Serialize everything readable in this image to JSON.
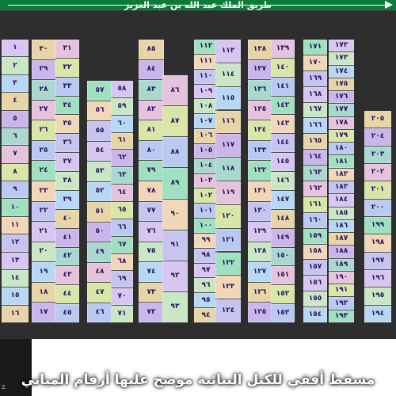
{
  "header": {
    "street_label": "طريق الملك عبد الله بن عبد العزيز"
  },
  "caption": "مسقط أفقي للكتل البنائية موضح عليها أرقام المباني",
  "corner_note": "2.",
  "colors": {
    "road_green": "#0c7a3a",
    "label_text": "#2a145e"
  },
  "map": {
    "columns": [
      {
        "id": 1,
        "labels": [
          "١",
          "٢",
          "٣",
          "٤",
          "٥",
          "٦",
          "٧",
          "٨",
          "٩",
          "١٠",
          "١١",
          "١٢",
          "١٣",
          "١٤",
          "١٥",
          "١٦"
        ]
      },
      {
        "id": 2,
        "labels": [
          "٣٠",
          "٢٩",
          "٢٨",
          "٢٧",
          "٢٦",
          "٢٥",
          "٢٤",
          "٢٣",
          "٢٢",
          "٢١",
          "٢٠",
          "١٩",
          "١٨",
          "١٧"
        ]
      },
      {
        "id": 3,
        "labels": [
          "٣١",
          "٣٢",
          "٣٣",
          "٣٤",
          "٣٥",
          "٣٦",
          "٣٧",
          "٣٨",
          "٣٩",
          "٤٠",
          "٤١",
          "٤٢",
          "٤٣",
          "٤٤",
          "٤٥"
        ]
      },
      {
        "id": 4,
        "labels": [
          "٥٧",
          "٥٦",
          "٥٥",
          "٥٤",
          "٥٣",
          "٥٢",
          "٥١",
          "٥٠",
          "٤٩",
          "٤٨",
          "٤٧",
          "٤٦"
        ]
      },
      {
        "id": 5,
        "labels": [
          "٥٨",
          "٥٩",
          "٦٠",
          "٦١",
          "٦٢",
          "٦٣",
          "٦٤",
          "٦٥",
          "٦٦",
          "٦٧",
          "٦٨",
          "٦٩",
          "٧٠",
          "٧١"
        ]
      },
      {
        "id": 6,
        "labels": [
          "٨٥",
          "٨٤",
          "٨٣",
          "٨٢",
          "٨١",
          "٨٠",
          "٧٩",
          "٧٨",
          "٧٧",
          "٧٦",
          "٧٥",
          "٧٤",
          "٧٣",
          "٧٢"
        ]
      },
      {
        "id": 7,
        "labels": [
          "٨٦",
          "٨٧",
          "٨٨",
          "٨٩",
          "٩٠",
          "٩١",
          "٩٢",
          "٩٣"
        ]
      },
      {
        "id": 8,
        "labels": [
          "١١٢",
          "١١١",
          "١١٠",
          "١٠٩",
          "١٠٨",
          "١٠٧",
          "١٠٦",
          "١٠٥",
          "١٠٤",
          "١٠٣",
          "١٠٢",
          "١٠١",
          "١٠٠",
          "٩٩",
          "٩٨",
          "٩٧",
          "٩٦",
          "٩٥",
          "٩٤"
        ]
      },
      {
        "id": 9,
        "labels": [
          "١١٣",
          "١١٤",
          "١١٥",
          "١١٦",
          "١١٧",
          "١١٨",
          "١١٩",
          "١٢٠",
          "١٢١",
          "١٢٢",
          "١٢٣",
          "١٢٤"
        ]
      },
      {
        "id": 10,
        "labels": [
          "١٣٨",
          "١٣٧",
          "١٣٦",
          "١٣٥",
          "١٣٤",
          "١٣٣",
          "١٣٢",
          "١٣١",
          "١٣٠",
          "١٢٩",
          "١٢٨",
          "١٢٧",
          "١٢٦",
          "١٢٥"
        ]
      },
      {
        "id": 11,
        "labels": [
          "١٣٩",
          "١٤٠",
          "١٤١",
          "١٤٢",
          "١٤٣",
          "١٤٤",
          "١٤٥",
          "١٤٦",
          "١٤٧",
          "١٤٨",
          "١٤٩",
          "١٥٠",
          "١٥١",
          "١٥٢",
          "١٥٣"
        ]
      },
      {
        "id": 12,
        "labels": [
          "١٧١",
          "١٧٠",
          "١٦٩",
          "١٦٨",
          "١٦٧",
          "١٦٦",
          "١٦٥",
          "١٦٤",
          "١٦٣",
          "١٦٢",
          "١٦١",
          "١٦٠",
          "١٥٩",
          "١٥٨",
          "١٥٧",
          "١٥٦",
          "١٥٥",
          "١٥٤"
        ]
      },
      {
        "id": 13,
        "labels": [
          "١٧٢",
          "١٧٣",
          "١٧٤",
          "١٧٥",
          "١٧٦",
          "١٧٧",
          "١٧٨",
          "١٧٩",
          "١٨٠",
          "١٨١",
          "١٨٢",
          "١٨٣",
          "١٨٤",
          "١٨٥",
          "١٨٦",
          "١٨٧",
          "١٨٨",
          "١٨٩",
          "١٩٠",
          "١٩١",
          "١٩٢",
          "١٩٣"
        ]
      },
      {
        "id": 14,
        "labels": [
          "٢٠٥",
          "٢٠٤",
          "٢٠٣",
          "٢٠٢",
          "٢٠١",
          "٢٠٠",
          "١٩٩",
          "١٩٨",
          "١٩٧",
          "١٩٦",
          "١٩٥",
          "١٩٤"
        ]
      }
    ]
  }
}
